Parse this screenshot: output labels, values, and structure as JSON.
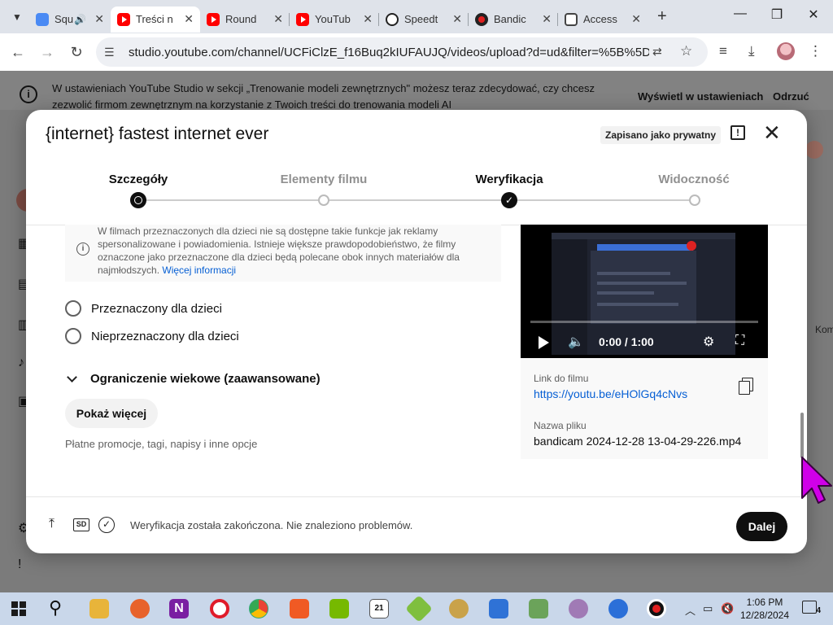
{
  "browser": {
    "tabs": [
      {
        "title": "Squ",
        "icon": "squarespace-icon",
        "audio": true
      },
      {
        "title": "Treści n",
        "icon": "youtube-studio-icon",
        "active": true
      },
      {
        "title": "Round",
        "icon": "youtube-studio-icon"
      },
      {
        "title": "YouTub",
        "icon": "youtube-icon"
      },
      {
        "title": "Speedt",
        "icon": "speedtest-icon"
      },
      {
        "title": "Bandic",
        "icon": "bandicam-icon"
      },
      {
        "title": "Access",
        "icon": "accessibility-icon"
      }
    ],
    "url": "studio.youtube.com/channel/UCFiClzE_f16Buq2kIUFAUJQ/videos/upload?d=ud&filter=%5B%5D&sor..."
  },
  "banner": {
    "text": "W ustawieniach YouTube Studio w sekcji „Trenowanie modeli zewnętrznych\" możesz teraz zdecydować, czy chcesz zezwolić firmom zewnętrznym na korzystanie z Twoich treści do trenowania modeli AI",
    "settings_link": "Wyświetl w ustawieniach",
    "dismiss": "Odrzuć"
  },
  "background": {
    "partial_text": "Kom"
  },
  "modal": {
    "title": "{internet} fastest internet ever",
    "saved_badge": "Zapisano jako prywatny",
    "steps": [
      {
        "label": "Szczegóły",
        "state": "current"
      },
      {
        "label": "Elementy filmu",
        "state": "inactive"
      },
      {
        "label": "Weryfikacja",
        "state": "done"
      },
      {
        "label": "Widoczność",
        "state": "inactive"
      }
    ],
    "info_text": "W filmach przeznaczonych dla dzieci nie są dostępne takie funkcje jak reklamy spersonalizowane i powiadomienia. Istnieje większe prawdopodobieństwo, że filmy oznaczone jako przeznaczone dla dzieci będą polecane obok innych materiałów dla najmłodszych.",
    "info_link": "Więcej informacji",
    "audience_options": [
      "Przeznaczony dla dzieci",
      "Nieprzeznaczony dla dzieci"
    ],
    "age_restriction": "Ograniczenie wiekowe (zaawansowane)",
    "show_more": "Pokaż więcej",
    "extra_options": "Płatne promocje, tagi, napisy i inne opcje",
    "video": {
      "time": "0:00 / 1:00",
      "link_label": "Link do filmu",
      "link": "https://youtu.be/eHOlGq4cNvs",
      "filename_label": "Nazwa pliku",
      "filename": "bandicam 2024-12-28 13-04-29-226.mp4"
    },
    "footer": {
      "sd_label": "SD",
      "status": "Weryfikacja została zakończona. Nie znaleziono problemów.",
      "next": "Dalej"
    }
  },
  "taskbar": {
    "time": "1:06 PM",
    "date": "12/28/2024",
    "notifications": "4",
    "calendar_day": "21"
  },
  "colors": {
    "link_blue": "#065fd4",
    "youtube_red": "#ff0000",
    "cursor_magenta": "#d000e8"
  }
}
